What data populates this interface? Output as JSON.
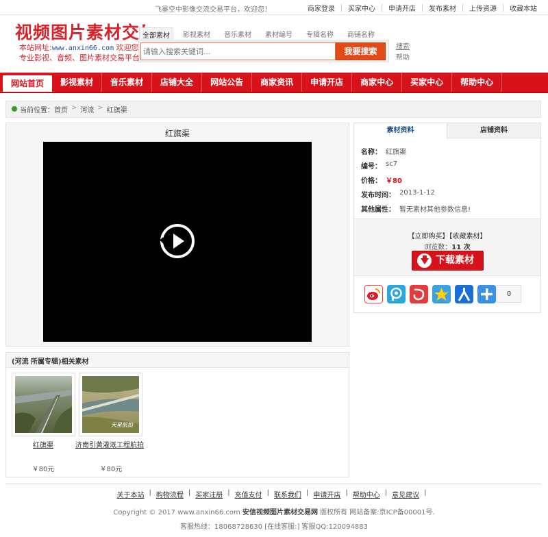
{
  "top": {
    "welcome": "飞墨空中影像交流交易平台，欢迎您！",
    "links": [
      "商家登录",
      "买家中心",
      "申请开店",
      "发布素材",
      "上传资源",
      "收藏本站"
    ]
  },
  "logo": {
    "title": "视频图片素材交易网",
    "url_label": "本站网址:",
    "url": "www.anxin66.com",
    "url_suffix": " 欢迎您",
    "subtitle": "专业影视、音频、图片素材交易平台"
  },
  "search": {
    "tabs": [
      "全部素材",
      "影视素材",
      "音乐素材",
      "素材编号",
      "专辑名称",
      "商铺名称"
    ],
    "placeholder": "请输入搜索关键词...",
    "button": "我要搜索",
    "search_link": "搜索",
    "help_link": "帮助"
  },
  "nav": {
    "items": [
      "网站首页",
      "影视素材",
      "音乐素材",
      "店铺大全",
      "网站公告",
      "商家资讯",
      "申请开店",
      "商家中心",
      "买家中心",
      "帮助中心"
    ]
  },
  "breadcrumb": {
    "label": "当前位置：",
    "items": [
      "首页",
      "河流",
      "红旗渠"
    ]
  },
  "video": {
    "title": "红旗渠"
  },
  "details": {
    "tabs": [
      "素材资料",
      "店铺资料"
    ],
    "name_label": "名称：",
    "name": "红旗渠",
    "code_label": "编号：",
    "code": "sc7",
    "price_label": "价格：",
    "price": "￥80",
    "date_label": "发布时间：",
    "date": "2013-1-12",
    "other_label": "其他属性：",
    "other": "暂无素材其他参数信息!",
    "buy_links": "【立即购买】【收藏素材】",
    "views_label": "浏览数：",
    "views": "11 次",
    "download": "下载素材",
    "share_count": "0",
    "colors": {
      "accent": "#d8121b",
      "tab_active": "#1d4e8a"
    }
  },
  "share_icons": [
    "weibo-icon",
    "tencent-weibo-icon",
    "netease-icon",
    "qzone-icon",
    "renren-icon",
    "more-share-icon"
  ],
  "related": {
    "title": "(河流 所属专辑)相关素材",
    "items": [
      {
        "name": "红旗渠",
        "price": "￥80元"
      },
      {
        "name": "济南引黄灌溉工程航拍",
        "price": "￥80元"
      }
    ]
  },
  "footer": {
    "links": [
      "关于本站",
      "购物流程",
      "买家注册",
      "充值支付",
      "联系我们",
      "申请开店",
      "帮助中心",
      "意见建议"
    ],
    "copyright_pre": "Copyright © 2017 www.anxin66.com ",
    "copyright_site": "安信视频图片素材交易网",
    "copyright_post": " 版权所有 网站备案:京ICP备00001号.",
    "hotline": "客服热线：18068728630 [在线客服:] 客服QQ:120094883"
  }
}
